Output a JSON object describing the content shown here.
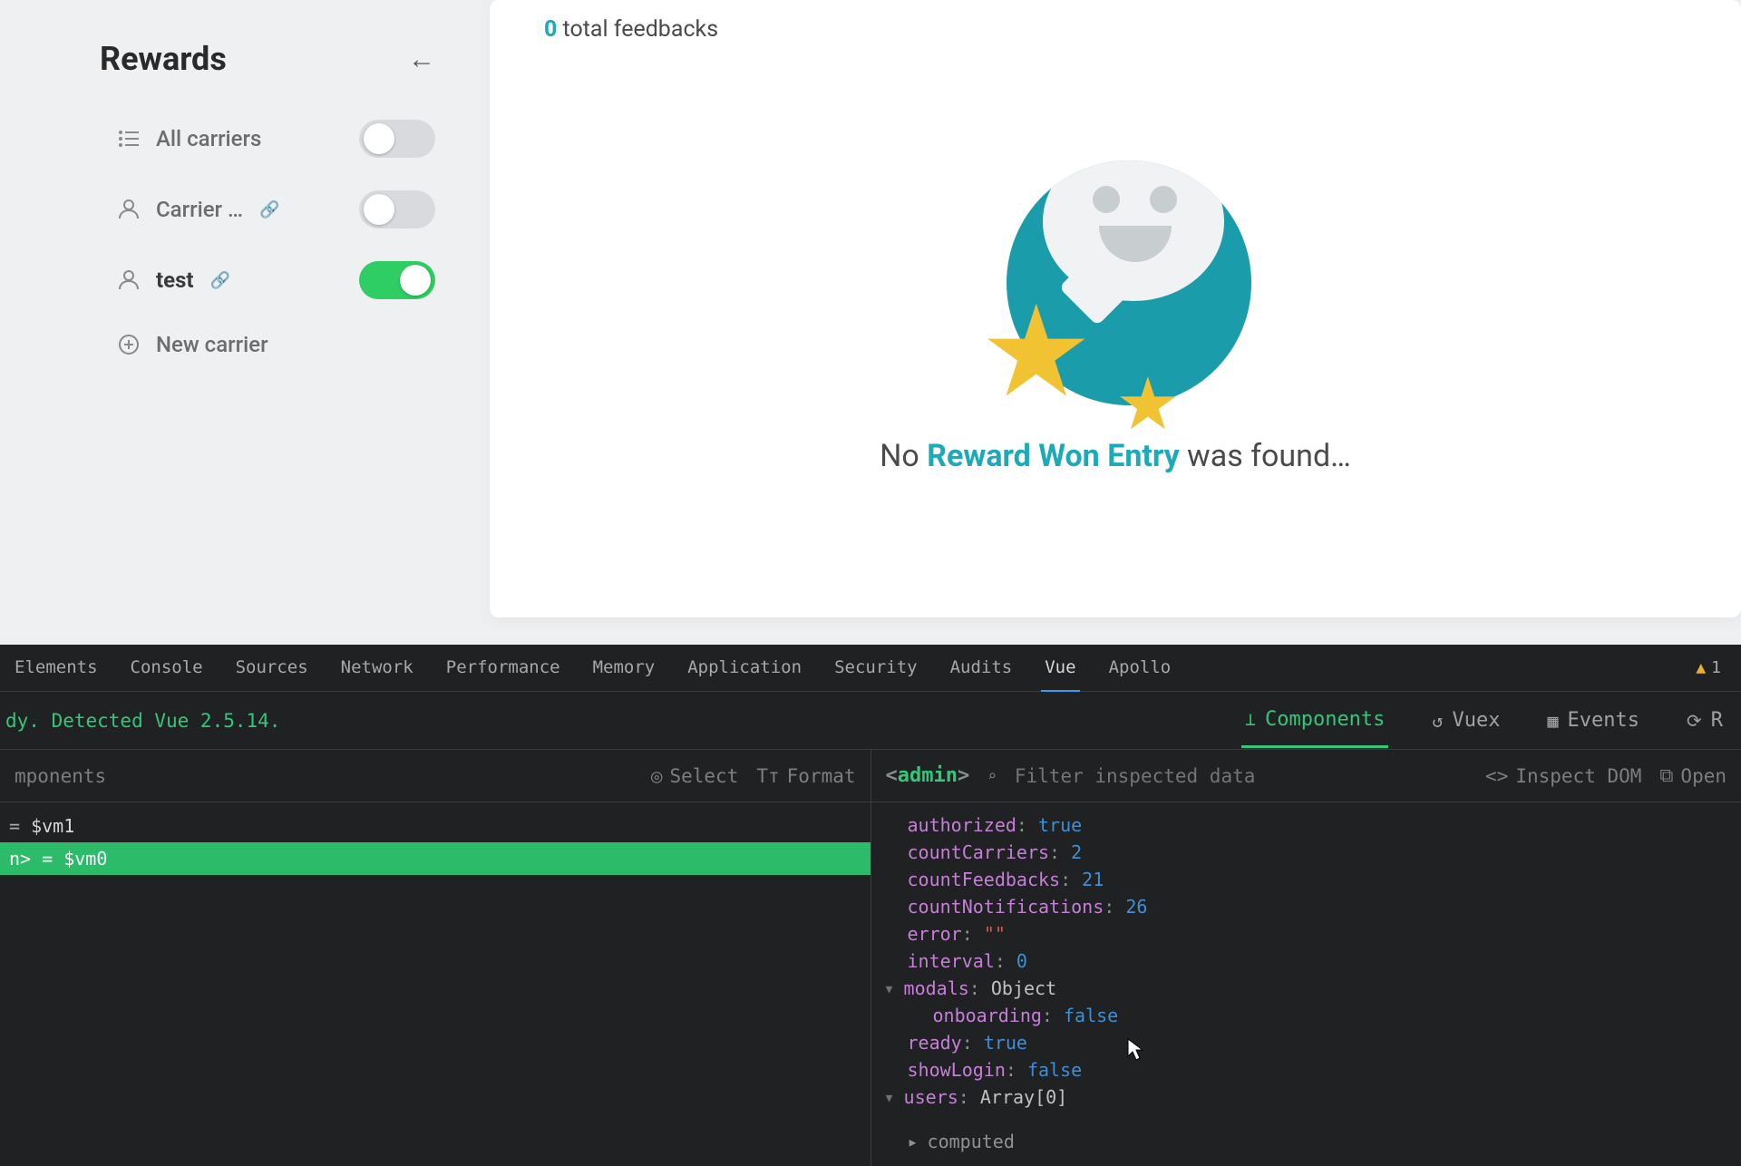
{
  "sidebar": {
    "title": "Rewards",
    "items": [
      {
        "label": "All carriers",
        "toggle": false,
        "bold": false,
        "link": false,
        "icon": "list"
      },
      {
        "label": "Carrier …",
        "toggle": false,
        "bold": false,
        "link": true,
        "icon": "person"
      },
      {
        "label": "test",
        "toggle": true,
        "bold": true,
        "link": true,
        "icon": "person"
      }
    ],
    "new_carrier": "New carrier"
  },
  "main": {
    "feedback_count": "0",
    "feedback_label": " total feedbacks",
    "empty_prefix": "No ",
    "empty_highlight": "Reward Won Entry",
    "empty_suffix": " was found…"
  },
  "devtools": {
    "tabs": [
      "Elements",
      "Console",
      "Sources",
      "Network",
      "Performance",
      "Memory",
      "Application",
      "Security",
      "Audits",
      "Vue",
      "Apollo"
    ],
    "active_tab": "Vue",
    "warning_count": "1",
    "vue_status": "dy. Detected Vue 2.5.14.",
    "vue_nav": [
      {
        "label": "Components",
        "active": true,
        "icon": "tree"
      },
      {
        "label": "Vuex",
        "active": false,
        "icon": "history"
      },
      {
        "label": "Events",
        "active": false,
        "icon": "grid"
      },
      {
        "label": "R",
        "active": false,
        "icon": "refresh"
      }
    ],
    "left_toolbar": {
      "filter_label": "mponents",
      "select": "Select",
      "format": "Format"
    },
    "right_toolbar": {
      "component": "admin",
      "filter_placeholder": "Filter inspected data",
      "inspect": "Inspect DOM",
      "open": "Open"
    },
    "tree": [
      {
        "text_eq": "= ",
        "text_var": "$vm1",
        "selected": false
      },
      {
        "text_cmp": "n>",
        "text_eq": " = ",
        "text_var": "$vm0",
        "selected": true
      }
    ],
    "props": [
      {
        "key": "authorized",
        "val": "true",
        "type": "b",
        "indent": 0,
        "tri": false
      },
      {
        "key": "countCarriers",
        "val": "2",
        "type": "n",
        "indent": 0,
        "tri": false
      },
      {
        "key": "countFeedbacks",
        "val": "21",
        "type": "n",
        "indent": 0,
        "tri": false
      },
      {
        "key": "countNotifications",
        "val": "26",
        "type": "n",
        "indent": 0,
        "tri": false
      },
      {
        "key": "error",
        "val": "\"\"",
        "type": "s",
        "indent": 0,
        "tri": false
      },
      {
        "key": "interval",
        "val": "0",
        "type": "n",
        "indent": 0,
        "tri": false
      },
      {
        "key": "modals",
        "val": "Object",
        "type": "t",
        "indent": 0,
        "tri": true
      },
      {
        "key": "onboarding",
        "val": "false",
        "type": "b",
        "indent": 1,
        "tri": false
      },
      {
        "key": "ready",
        "val": "true",
        "type": "b",
        "indent": 0,
        "tri": false
      },
      {
        "key": "showLogin",
        "val": "false",
        "type": "b",
        "indent": 0,
        "tri": false
      },
      {
        "key": "users",
        "val": "Array[0]",
        "type": "t",
        "indent": 0,
        "tri": true
      }
    ],
    "section": "computed"
  }
}
